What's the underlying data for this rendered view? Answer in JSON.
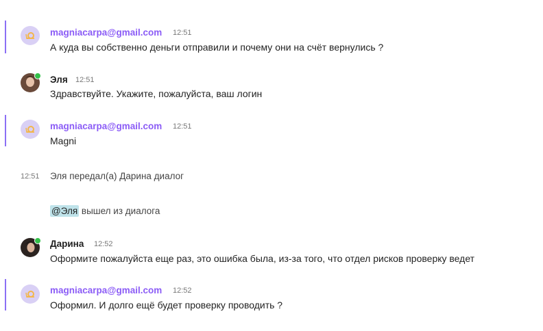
{
  "colors": {
    "accent": "#8b5cf6",
    "online": "#34c04a",
    "mention_bg": "#bfe3ea"
  },
  "messages": [
    {
      "author": "magniacarpa@gmail.com",
      "time": "12:51",
      "text": "А куда вы собственно деньги отправили и почему они на счёт вернулись ?"
    },
    {
      "author": "Эля",
      "time": "12:51",
      "text": "Здравствуйте. Укажите, пожалуйста, ваш логин"
    },
    {
      "author": "magniacarpa@gmail.com",
      "time": "12:51",
      "text": "Magni"
    },
    {
      "author": "Дарина",
      "time": "12:52",
      "text": "Оформите пожалуйста еще раз, это ошибка была, из-за того, что отдел рисков проверку ведет"
    },
    {
      "author": "magniacarpa@gmail.com",
      "time": "12:52",
      "text": "Оформил. И долго ещё будет проверку проводить ?"
    }
  ],
  "system": [
    {
      "time": "12:51",
      "text": "Эля передал(а) Дарина диалог"
    },
    {
      "mention": "@Эля",
      "text": " вышел из диалога"
    }
  ]
}
